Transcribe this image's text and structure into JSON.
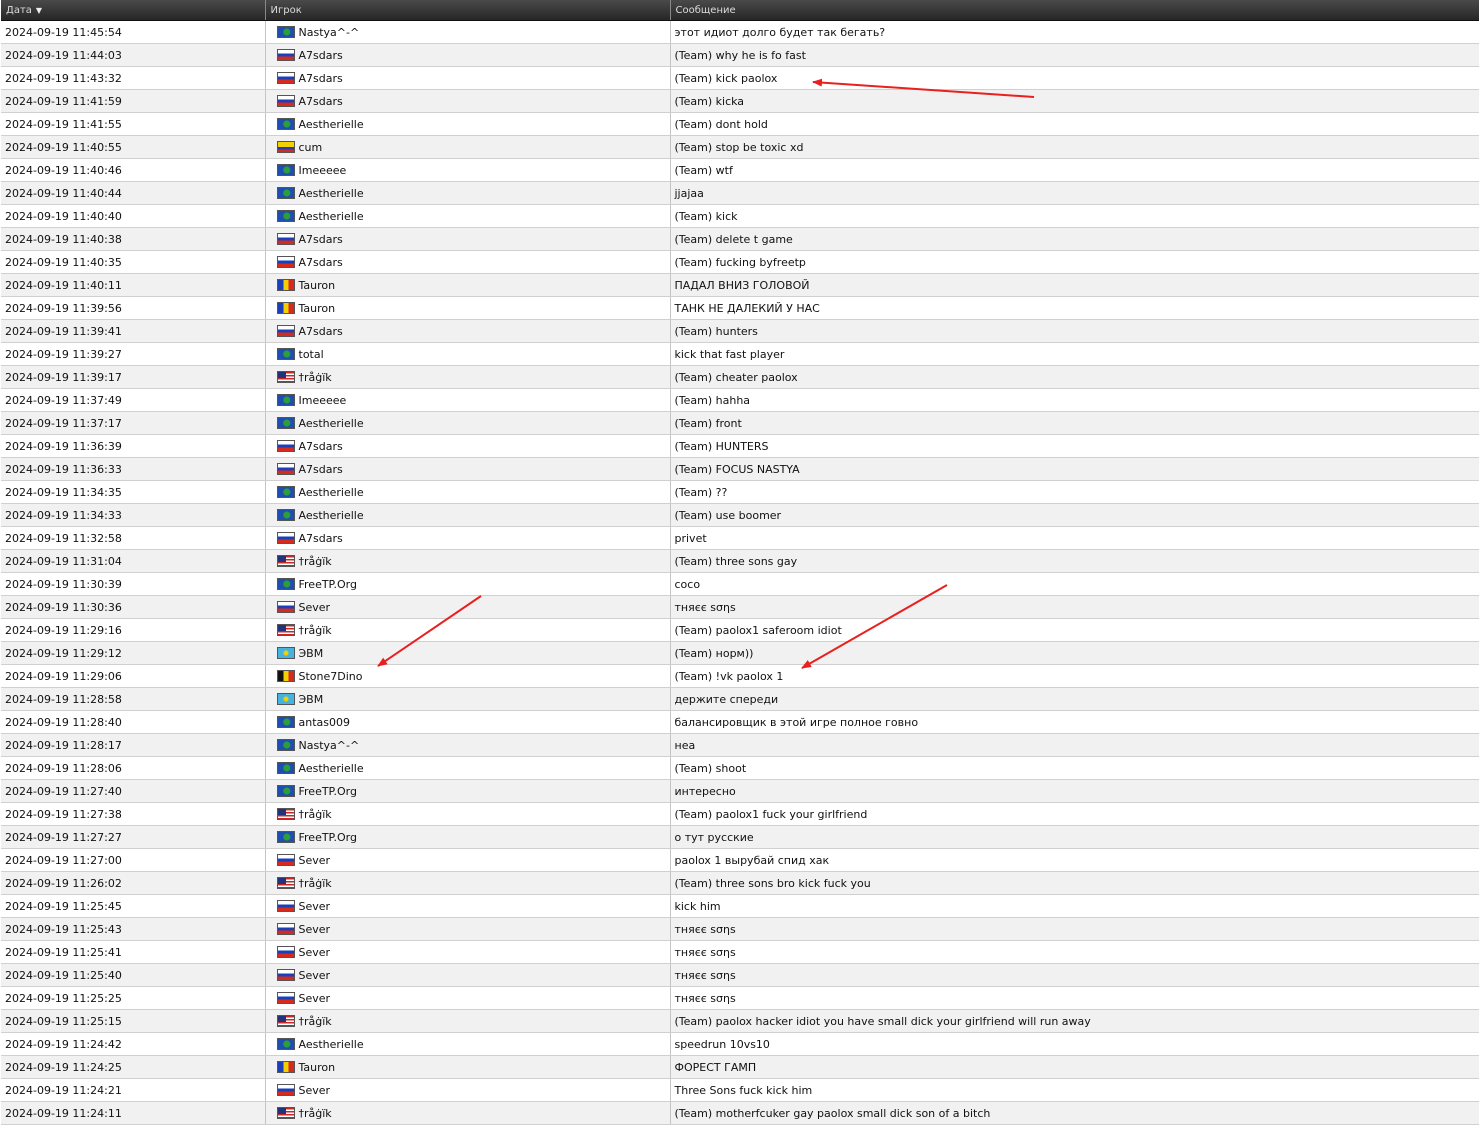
{
  "header": {
    "date_label": "Дата",
    "sort_icon": "sort-desc-icon",
    "player_label": "Игрок",
    "message_label": "Сообщение"
  },
  "rows": [
    {
      "date": "2024-09-19 11:45:54",
      "flag": "world",
      "player": "Nastya^-^",
      "message": "этот идиот долго будет так бегать?"
    },
    {
      "date": "2024-09-19 11:44:03",
      "flag": "ru",
      "player": "A7sdars",
      "message": "(Team) why he is fo fast"
    },
    {
      "date": "2024-09-19 11:43:32",
      "flag": "ru",
      "player": "A7sdars",
      "message": "(Team) kick paolox"
    },
    {
      "date": "2024-09-19 11:41:59",
      "flag": "ru",
      "player": "A7sdars",
      "message": "(Team) kicka"
    },
    {
      "date": "2024-09-19 11:41:55",
      "flag": "world",
      "player": "Aestherielle",
      "message": "(Team) dont hold"
    },
    {
      "date": "2024-09-19 11:40:55",
      "flag": "co",
      "player": "cum",
      "message": "(Team) stop be toxic xd"
    },
    {
      "date": "2024-09-19 11:40:46",
      "flag": "world",
      "player": "Imeeeee",
      "message": "(Team) wtf"
    },
    {
      "date": "2024-09-19 11:40:44",
      "flag": "world",
      "player": "Aestherielle",
      "message": "jjajaa"
    },
    {
      "date": "2024-09-19 11:40:40",
      "flag": "world",
      "player": "Aestherielle",
      "message": "(Team) kick"
    },
    {
      "date": "2024-09-19 11:40:38",
      "flag": "ru",
      "player": "A7sdars",
      "message": "(Team) delete t game"
    },
    {
      "date": "2024-09-19 11:40:35",
      "flag": "ru",
      "player": "A7sdars",
      "message": "(Team) fucking byfreetp"
    },
    {
      "date": "2024-09-19 11:40:11",
      "flag": "md",
      "player": "Tauron",
      "message": "ПАДАЛ ВНИЗ ГОЛОВОЙ"
    },
    {
      "date": "2024-09-19 11:39:56",
      "flag": "md",
      "player": "Tauron",
      "message": "ТАНК НЕ ДАЛЕКИЙ У НАС"
    },
    {
      "date": "2024-09-19 11:39:41",
      "flag": "ru",
      "player": "A7sdars",
      "message": "(Team) hunters"
    },
    {
      "date": "2024-09-19 11:39:27",
      "flag": "world",
      "player": "total",
      "message": "kick that fast player"
    },
    {
      "date": "2024-09-19 11:39:17",
      "flag": "us",
      "player": "†råġïk",
      "message": "(Team) cheater paolox"
    },
    {
      "date": "2024-09-19 11:37:49",
      "flag": "world",
      "player": "Imeeeee",
      "message": "(Team) hahha"
    },
    {
      "date": "2024-09-19 11:37:17",
      "flag": "world",
      "player": "Aestherielle",
      "message": "(Team) front"
    },
    {
      "date": "2024-09-19 11:36:39",
      "flag": "ru",
      "player": "A7sdars",
      "message": "(Team) HUNTERS"
    },
    {
      "date": "2024-09-19 11:36:33",
      "flag": "ru",
      "player": "A7sdars",
      "message": "(Team) FOCUS NASTYA"
    },
    {
      "date": "2024-09-19 11:34:35",
      "flag": "world",
      "player": "Aestherielle",
      "message": "(Team) ??"
    },
    {
      "date": "2024-09-19 11:34:33",
      "flag": "world",
      "player": "Aestherielle",
      "message": "(Team) use boomer"
    },
    {
      "date": "2024-09-19 11:32:58",
      "flag": "ru",
      "player": "A7sdars",
      "message": "privet"
    },
    {
      "date": "2024-09-19 11:31:04",
      "flag": "us",
      "player": "†råġïk",
      "message": "(Team) three sons gay"
    },
    {
      "date": "2024-09-19 11:30:39",
      "flag": "world",
      "player": "FreeTP.Org",
      "message": "coco"
    },
    {
      "date": "2024-09-19 11:30:36",
      "flag": "ru",
      "player": "Sever",
      "message": "тняєє ѕσηѕ"
    },
    {
      "date": "2024-09-19 11:29:16",
      "flag": "us",
      "player": "†råġïk",
      "message": "(Team) paolox1 saferoom idiot"
    },
    {
      "date": "2024-09-19 11:29:12",
      "flag": "kz",
      "player": "ЭВМ",
      "message": "(Team) норм))"
    },
    {
      "date": "2024-09-19 11:29:06",
      "flag": "be",
      "player": "Stone7Dino",
      "message": "(Team) !vk paolox 1"
    },
    {
      "date": "2024-09-19 11:28:58",
      "flag": "kz",
      "player": "ЭВМ",
      "message": "держите спереди"
    },
    {
      "date": "2024-09-19 11:28:40",
      "flag": "world",
      "player": "antas009",
      "message": "балансировщик в этой игре полное говно"
    },
    {
      "date": "2024-09-19 11:28:17",
      "flag": "world",
      "player": "Nastya^-^",
      "message": "неа"
    },
    {
      "date": "2024-09-19 11:28:06",
      "flag": "world",
      "player": "Aestherielle",
      "message": "(Team) shoot"
    },
    {
      "date": "2024-09-19 11:27:40",
      "flag": "world",
      "player": "FreeTP.Org",
      "message": "интересно"
    },
    {
      "date": "2024-09-19 11:27:38",
      "flag": "us",
      "player": "†råġïk",
      "message": "(Team) paolox1 fuck your girlfriend"
    },
    {
      "date": "2024-09-19 11:27:27",
      "flag": "world",
      "player": "FreeTP.Org",
      "message": "о тут русские"
    },
    {
      "date": "2024-09-19 11:27:00",
      "flag": "ru",
      "player": "Sever",
      "message": "paolox 1 вырубай спид хак"
    },
    {
      "date": "2024-09-19 11:26:02",
      "flag": "us",
      "player": "†råġïk",
      "message": "(Team) three sons bro kick fuck you"
    },
    {
      "date": "2024-09-19 11:25:45",
      "flag": "ru",
      "player": "Sever",
      "message": "kick him"
    },
    {
      "date": "2024-09-19 11:25:43",
      "flag": "ru",
      "player": "Sever",
      "message": "тняєє ѕσηѕ"
    },
    {
      "date": "2024-09-19 11:25:41",
      "flag": "ru",
      "player": "Sever",
      "message": "тняєє ѕσηѕ"
    },
    {
      "date": "2024-09-19 11:25:40",
      "flag": "ru",
      "player": "Sever",
      "message": "тняєє ѕσηѕ"
    },
    {
      "date": "2024-09-19 11:25:25",
      "flag": "ru",
      "player": "Sever",
      "message": "тняєє ѕσηѕ"
    },
    {
      "date": "2024-09-19 11:25:15",
      "flag": "us",
      "player": "†råġïk",
      "message": "(Team) paolox hacker idiot you have small dick your girlfriend will run away"
    },
    {
      "date": "2024-09-19 11:24:42",
      "flag": "world",
      "player": "Aestherielle",
      "message": "speedrun 10vs10"
    },
    {
      "date": "2024-09-19 11:24:25",
      "flag": "md",
      "player": "Tauron",
      "message": "ФОРЕСТ ГАМП"
    },
    {
      "date": "2024-09-19 11:24:21",
      "flag": "ru",
      "player": "Sever",
      "message": "Three Sons fuck kick him"
    },
    {
      "date": "2024-09-19 11:24:11",
      "flag": "us",
      "player": "†råġïk",
      "message": "(Team) motherfcuker gay paolox small dick son of a bitch"
    }
  ],
  "annotations": {
    "color": "#e8201e",
    "arrows": [
      "annotation-arrow-kick-paolox",
      "annotation-arrow-stone7dino",
      "annotation-arrow-vk-paolox"
    ]
  }
}
